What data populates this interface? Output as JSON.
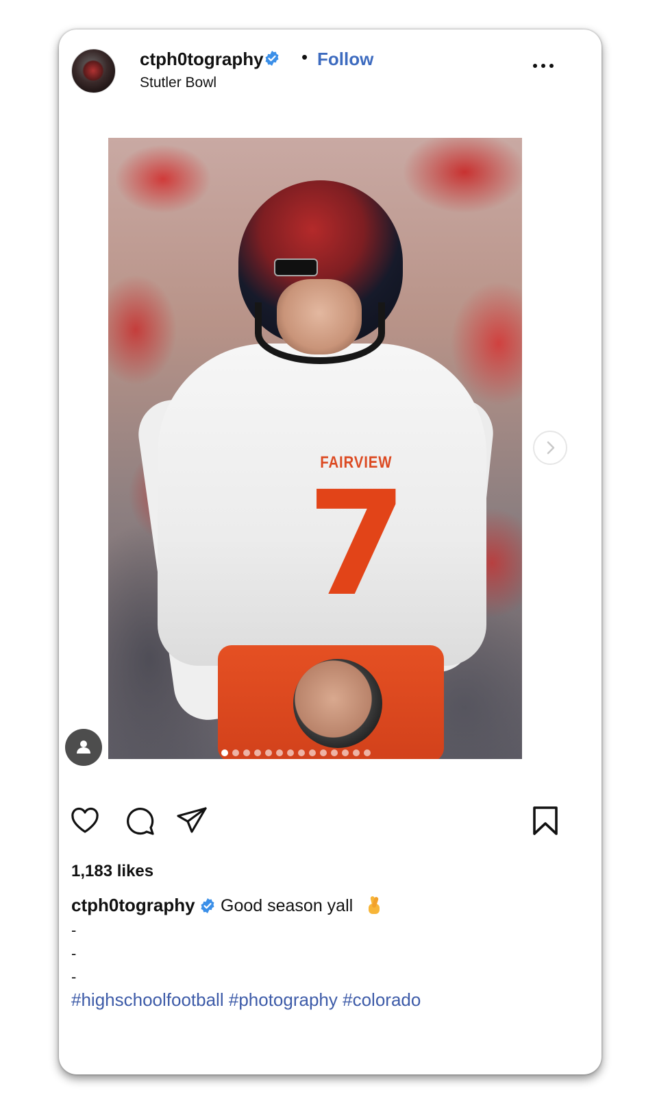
{
  "post": {
    "username": "ctph0tography",
    "separator": "•",
    "follow_label": "Follow",
    "location": "Stutler Bowl",
    "likes": "1,183 likes",
    "caption_user": "ctph0tography",
    "caption_text": "Good season yall",
    "caption_emoji": "crossed-fingers-emoji",
    "caption_lines": [
      "-",
      "-",
      "-"
    ],
    "hashtags": [
      "#highschoolfootball",
      "#photography",
      "#colorado"
    ],
    "photo": {
      "jersey_word": "FAIRVIEW",
      "jersey_number": "7",
      "carousel_count": 14,
      "carousel_active_index": 0
    }
  },
  "icons": {
    "verified": "verified-badge-icon",
    "more": "more-options-icon",
    "like": "heart-icon",
    "comment": "comment-icon",
    "share": "send-icon",
    "save": "bookmark-icon",
    "next": "chevron-right-icon",
    "tag": "user-tag-icon"
  },
  "colors": {
    "link": "#3d6bbf",
    "hashtag": "#3d5ba8",
    "verified": "#3b8fe8",
    "text": "#111111"
  }
}
